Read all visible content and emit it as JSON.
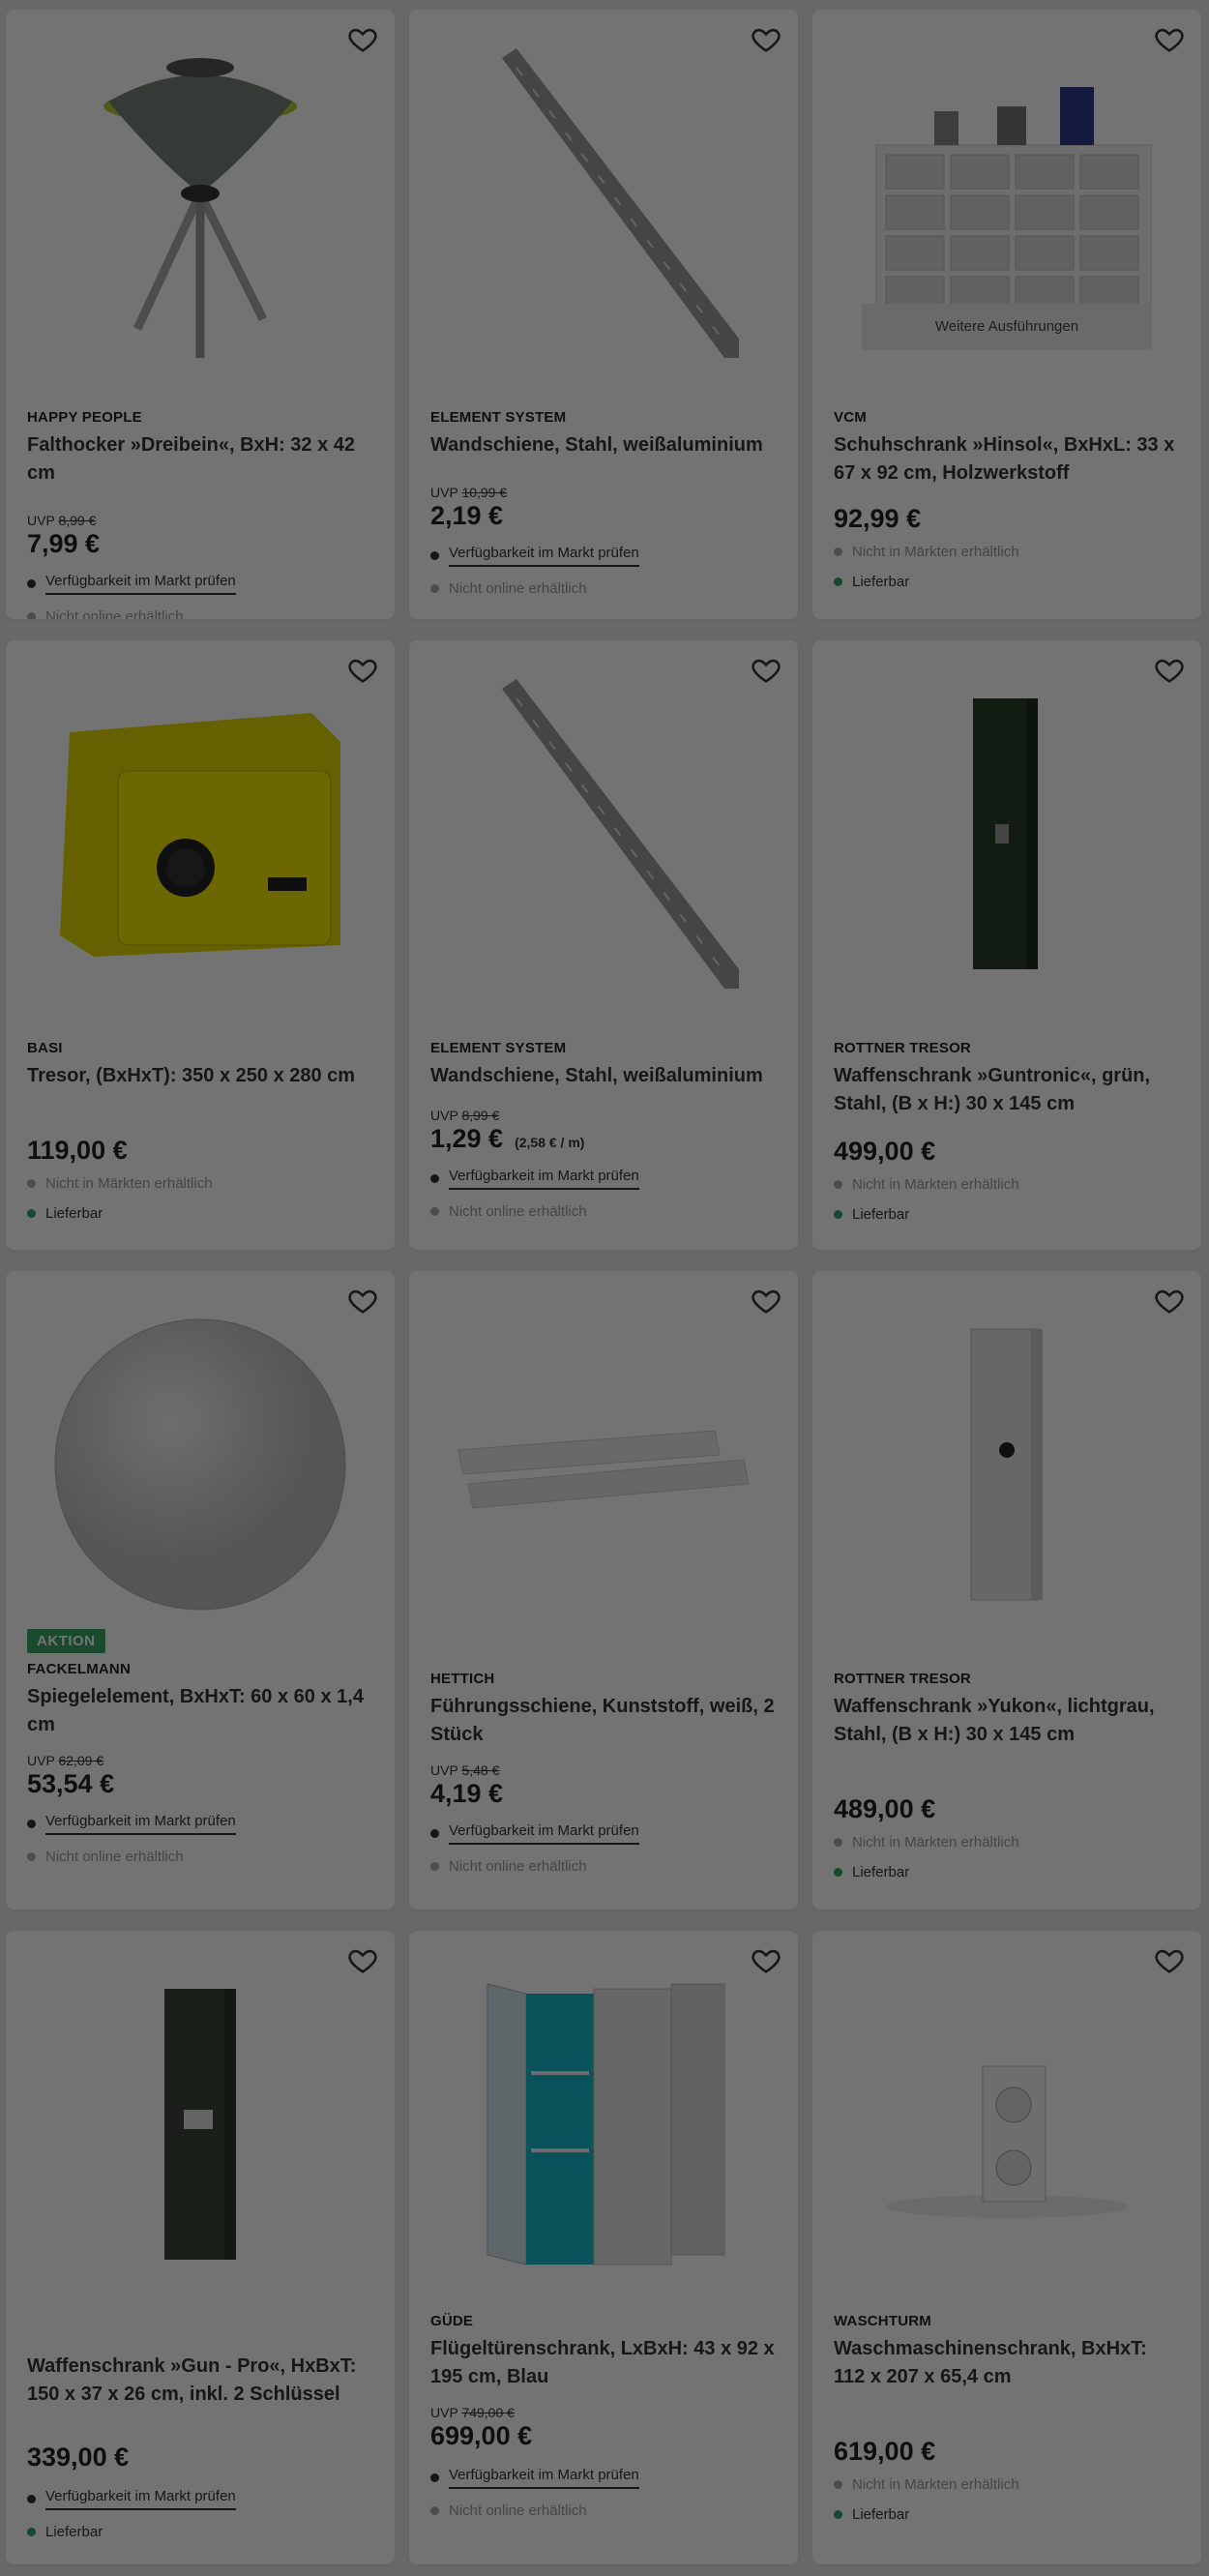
{
  "products": [
    {
      "brand": "HAPPY PEOPLE",
      "title": "Falthocker »Dreibein«, BxH: 32 x 42 cm",
      "uvp_label": "UVP",
      "uvp": "8,99 €",
      "price": "7,99 €",
      "avail1": "Verfügbarkeit im Markt prüfen",
      "avail2": "Nicht online erhältlich",
      "image": "tripod-stool-image"
    },
    {
      "brand": "ELEMENT SYSTEM",
      "title": "Wandschiene, Stahl, weißaluminium",
      "uvp_label": "UVP",
      "uvp": "10,99 €",
      "price": "2,19 €",
      "avail1": "Verfügbarkeit im Markt prüfen",
      "avail2": "Nicht online erhältlich",
      "image": "wall-rail-image"
    },
    {
      "brand": "VCM",
      "title": "Schuhschrank »Hinsol«, BxHxL: 33 x 67 x 92 cm, Holzwerkstoff",
      "price": "92,99 €",
      "avail1": "Nicht in Märkten erhältlich",
      "avail2": "Lieferbar",
      "more": "Weitere Ausführungen",
      "image": "shoe-cabinet-image"
    },
    {
      "brand": "BASI",
      "title": "Tresor, (BxHxT): 350 x 250 x 280 cm",
      "price": "119,00 €",
      "avail1": "Nicht in Märkten erhältlich",
      "avail2": "Lieferbar",
      "image": "safe-image"
    },
    {
      "brand": "ELEMENT SYSTEM",
      "title": "Wandschiene, Stahl, weißaluminium",
      "uvp_label": "UVP",
      "uvp": "8,99 €",
      "price": "1,29 €",
      "unit": "(2,58 € / m)",
      "avail1": "Verfügbarkeit im Markt prüfen",
      "avail2": "Nicht online erhältlich",
      "image": "wall-rail-image"
    },
    {
      "brand": "ROTTNER TRESOR",
      "title": "Waffenschrank »Guntronic«, grün, Stahl, (B x H:) 30 x 145 cm",
      "price": "499,00 €",
      "avail1": "Nicht in Märkten erhältlich",
      "avail2": "Lieferbar",
      "image": "gun-cabinet-image"
    },
    {
      "badge": "AKTION",
      "brand": "FACKELMANN",
      "title": "Spiegelelement, BxHxT: 60 x 60 x 1,4 cm",
      "uvp_label": "UVP",
      "uvp": "62,09 €",
      "price": "53,54 €",
      "avail1": "Verfügbarkeit im Markt prüfen",
      "avail2": "Nicht online erhältlich",
      "image": "round-mirror-image"
    },
    {
      "brand": "HETTICH",
      "title": "Führungsschiene, Kunststoff, weiß, 2 Stück",
      "uvp_label": "UVP",
      "uvp": "5,48 €",
      "price": "4,19 €",
      "avail1": "Verfügbarkeit im Markt prüfen",
      "avail2": "Nicht online erhältlich",
      "image": "guide-rail-image"
    },
    {
      "brand": "ROTTNER TRESOR",
      "title": "Waffenschrank »Yukon«, lichtgrau, Stahl, (B x H:) 30 x 145 cm",
      "price": "489,00 €",
      "avail1": "Nicht in Märkten erhältlich",
      "avail2": "Lieferbar",
      "image": "grey-gun-cabinet-image"
    },
    {
      "brand": "",
      "title": "Waffenschrank »Gun - Pro«, HxBxT: 150 x 37 x 26 cm, inkl. 2 Schlüssel",
      "price": "339,00 €",
      "avail1": "Verfügbarkeit im Markt prüfen",
      "avail2": "Lieferbar",
      "image": "gun-pro-cabinet-image"
    },
    {
      "brand": "GÜDE",
      "title": "Flügeltürenschrank, LxBxH: 43 x 92 x 195 cm, Blau",
      "uvp_label": "UVP",
      "uvp": "749,00 €",
      "price": "699,00 €",
      "avail1": "Verfügbarkeit im Markt prüfen",
      "avail2": "Nicht online erhältlich",
      "image": "double-door-cabinet-image"
    },
    {
      "brand": "WASCHTURM",
      "title": "Waschmaschinenschrank, BxHxT: 112 x 207 x 65,4 cm",
      "price": "619,00 €",
      "avail1": "Nicht in Märkten erhältlich",
      "avail2": "Lieferbar",
      "image": "washer-cabinet-image"
    }
  ],
  "colors": {
    "card": "#ffffff",
    "page": "#e6e6e6",
    "overlay": "rgba(0,0,0,0.55)",
    "badge": "#3aa565",
    "available": "#2fa36b"
  }
}
